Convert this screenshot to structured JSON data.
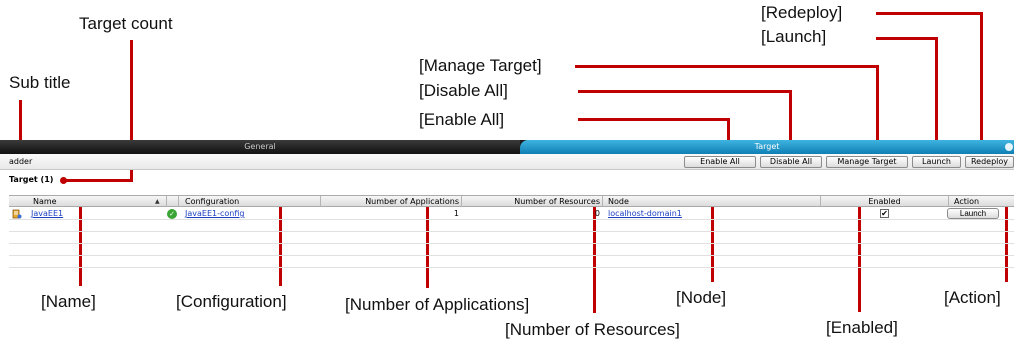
{
  "annotations": {
    "sub_title": "Sub title",
    "target_count": "Target count",
    "redeploy": "[Redeploy]",
    "launch": "[Launch]",
    "manage_target": "[Manage Target]",
    "disable_all": "[Disable All]",
    "enable_all": "[Enable All]",
    "name": "[Name]",
    "configuration": "[Configuration]",
    "number_of_applications": "[Number of Applications]",
    "number_of_resources": "[Number of Resources]",
    "node": "[Node]",
    "enabled": "[Enabled]",
    "action": "[Action]"
  },
  "tabs": {
    "general": "General",
    "target": "Target"
  },
  "subtitle": "adder",
  "toolbar": {
    "enable_all": "Enable All",
    "disable_all": "Disable All",
    "manage_target": "Manage Target",
    "launch": "Launch",
    "redeploy": "Redeploy"
  },
  "target_count_label": "Target (1)",
  "table": {
    "headers": {
      "name": "Name",
      "sort_arrow": "▲",
      "configuration": "Configuration",
      "number_of_applications": "Number of Applications",
      "number_of_resources": "Number of Resources",
      "node": "Node",
      "enabled": "Enabled",
      "action": "Action"
    },
    "rows": [
      {
        "name": "JavaEE1",
        "configuration": "JavaEE1-config",
        "number_of_applications": "1",
        "number_of_resources": "0",
        "node": "localhost-domain1",
        "enabled": true,
        "enabled_mark": "✔",
        "action_label": "Launch"
      }
    ]
  },
  "colors": {
    "callout": "#c00000",
    "target_tab": "#1e95c8",
    "link": "#1a3fc2",
    "status_ok": "#3aa535"
  },
  "icons": {
    "server": "server-icon",
    "status": "check-circle-icon"
  }
}
